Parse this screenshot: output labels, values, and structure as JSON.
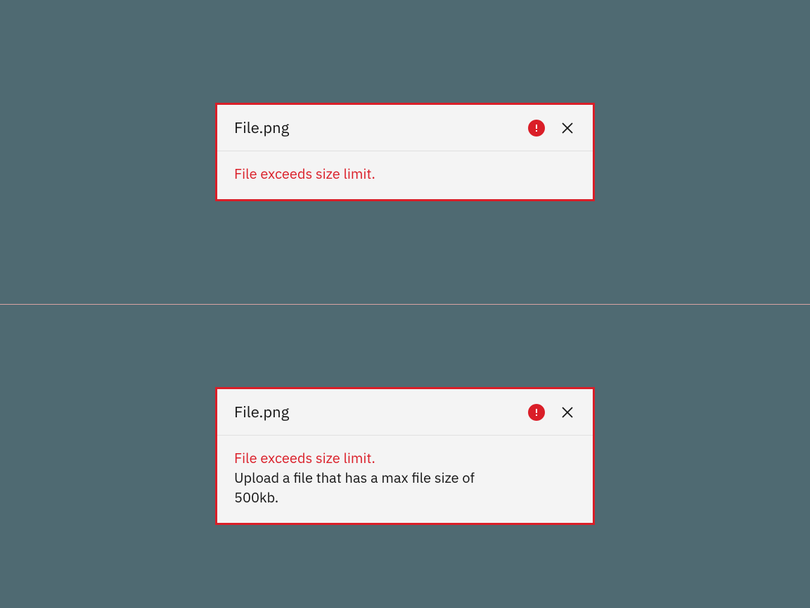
{
  "examples": [
    {
      "filename": "File.png",
      "error_title": "File exceeds size limit.",
      "error_description": null
    },
    {
      "filename": "File.png",
      "error_title": "File exceeds size limit.",
      "error_description": "Upload a file that has a max file size of 500kb."
    }
  ]
}
